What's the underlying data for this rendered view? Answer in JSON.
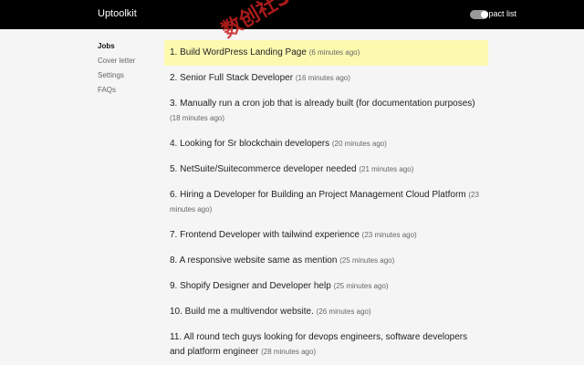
{
  "header": {
    "brand": "Uptoolkit",
    "compact_label": "Compact list",
    "compact_on": true
  },
  "sidebar": {
    "items": [
      {
        "label": "Jobs",
        "active": true
      },
      {
        "label": "Cover letter",
        "active": false
      },
      {
        "label": "Settings",
        "active": false
      },
      {
        "label": "FAQs",
        "active": false
      }
    ]
  },
  "jobs": [
    {
      "title": "1. Build WordPress Landing Page",
      "time": "(6 minutes ago)"
    },
    {
      "title": "2. Senior Full Stack Developer",
      "time": "(16 minutes ago)"
    },
    {
      "title": "3. Manually run a cron job that is already built (for documentation purposes)",
      "time": "(18 minutes ago)"
    },
    {
      "title": "4. Looking for Sr blockchain developers",
      "time": "(20 minutes ago)"
    },
    {
      "title": "5. NetSuite/Suitecommerce developer needed",
      "time": "(21 minutes ago)"
    },
    {
      "title": "6. Hiring a Developer for Building an Project Management Cloud Platform",
      "time": "(23 minutes ago)"
    },
    {
      "title": "7. Frontend Developer with tailwind experience",
      "time": "(23 minutes ago)"
    },
    {
      "title": "8. A responsive website same as mention",
      "time": "(25 minutes ago)"
    },
    {
      "title": "9. Shopify Designer and Developer help",
      "time": "(25 minutes ago)"
    },
    {
      "title": "10. Build me a multivendor website.",
      "time": "(26 minutes ago)"
    },
    {
      "title": "11. All round tech guys looking for devops engineers, software developers and platform engineer",
      "time": "(28 minutes ago)"
    }
  ],
  "watermark": "数创社Ss66",
  "colors": {
    "highlight": "#fdfab0",
    "topbar": "#000000"
  }
}
